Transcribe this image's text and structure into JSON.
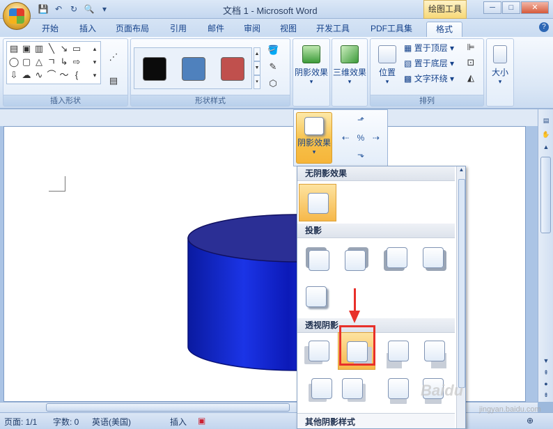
{
  "window": {
    "title": "文档 1 - Microsoft Word",
    "context_tab": "绘图工具",
    "buttons": [
      "─",
      "□",
      "✕"
    ]
  },
  "quick_access": {
    "icons": [
      "save-icon",
      "undo-icon",
      "redo-icon",
      "print-preview-icon",
      "customize-icon"
    ]
  },
  "ribbon_tabs": [
    {
      "label": "开始"
    },
    {
      "label": "插入"
    },
    {
      "label": "页面布局"
    },
    {
      "label": "引用"
    },
    {
      "label": "邮件"
    },
    {
      "label": "审阅"
    },
    {
      "label": "视图"
    },
    {
      "label": "开发工具"
    },
    {
      "label": "PDF工具集"
    },
    {
      "label": "格式",
      "active": true
    }
  ],
  "groups": {
    "insert_shapes": {
      "label": "插入形状"
    },
    "shape_styles": {
      "label": "形状样式",
      "swatches": [
        "#0b0b0b",
        "#4f81bd",
        "#c0504d"
      ]
    },
    "shadow": {
      "label": "阴影效果"
    },
    "threed": {
      "label": "三维效果"
    },
    "arrange": {
      "label": "排列",
      "position": "位置",
      "bring_front": "置于顶层",
      "send_back": "置于底层",
      "text_wrap": "文字环绕"
    },
    "size": {
      "label": "大小"
    }
  },
  "flyout": {
    "label": "阴影效果"
  },
  "gallery": {
    "sections": [
      {
        "header": "无阴影效果"
      },
      {
        "header": "投影"
      },
      {
        "header": "透视阴影"
      }
    ],
    "footer": "其他阴影样式"
  },
  "document": {
    "cylinder": {
      "color": "#1a2fd6"
    }
  },
  "statusbar": {
    "page": "页面: 1/1",
    "words": "字数: 0",
    "language": "英语(美国)",
    "mode": "插入"
  },
  "watermark": {
    "text": "Baidu",
    "sub": "jingyan.baidu.com"
  }
}
